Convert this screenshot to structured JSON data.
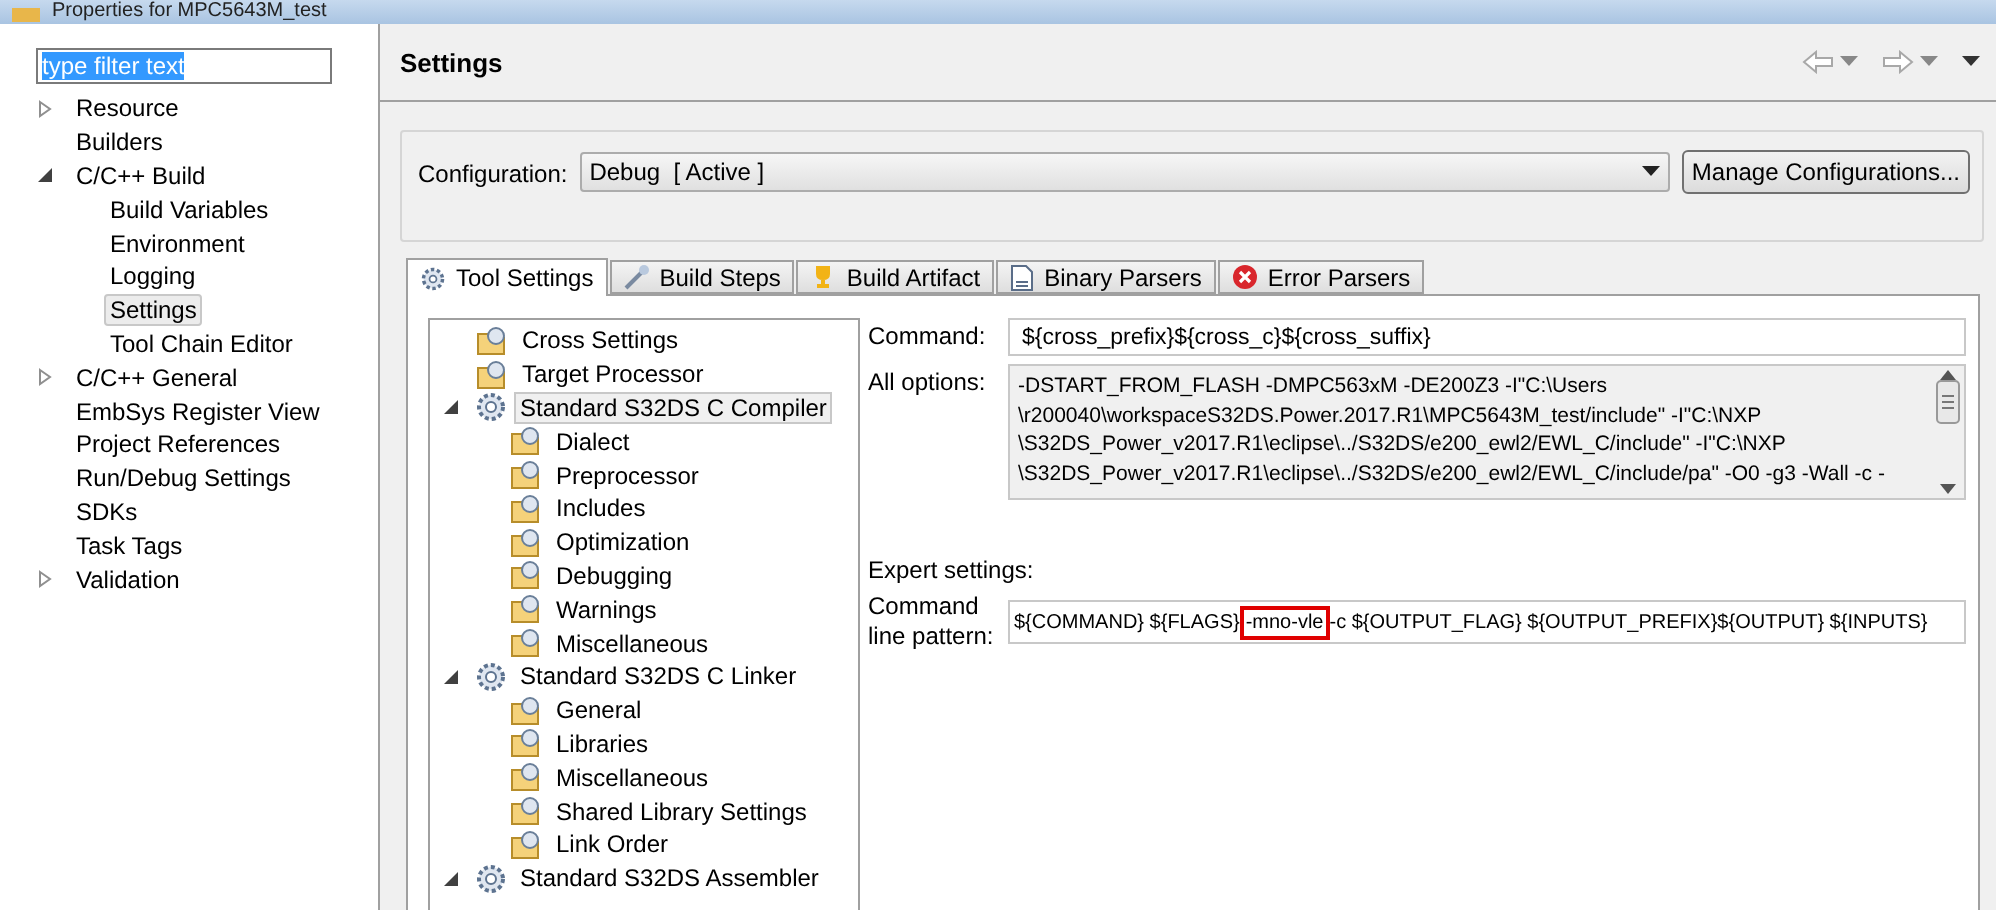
{
  "window": {
    "title": "Properties for MPC5643M_test"
  },
  "filter": {
    "value": "type filter text"
  },
  "nav_tree": [
    {
      "label": "Resource",
      "expanded": false,
      "selected": false
    },
    {
      "label": "Builders",
      "selected": false
    },
    {
      "label": "C/C++ Build",
      "expanded": true,
      "selected": false,
      "children": [
        {
          "label": "Build Variables",
          "selected": false
        },
        {
          "label": "Environment",
          "selected": false
        },
        {
          "label": "Logging",
          "selected": false
        },
        {
          "label": "Settings",
          "selected": true
        },
        {
          "label": "Tool Chain Editor",
          "selected": false
        }
      ]
    },
    {
      "label": "C/C++ General",
      "expanded": false,
      "selected": false
    },
    {
      "label": "EmbSys Register View",
      "selected": false
    },
    {
      "label": "Project References",
      "selected": false
    },
    {
      "label": "Run/Debug Settings",
      "selected": false
    },
    {
      "label": "SDKs",
      "selected": false
    },
    {
      "label": "Task Tags",
      "selected": false
    },
    {
      "label": "Validation",
      "expanded": false,
      "selected": false
    }
  ],
  "page": {
    "title": "Settings"
  },
  "configuration": {
    "label": "Configuration:",
    "value": "Debug  [ Active ]",
    "button": "Manage Configurations..."
  },
  "tabs": [
    {
      "label": "Tool Settings",
      "kind": "gear",
      "selected": true
    },
    {
      "label": "Build Steps",
      "kind": "wand",
      "selected": false
    },
    {
      "label": "Build Artifact",
      "kind": "trophy",
      "selected": false
    },
    {
      "label": "Binary Parsers",
      "kind": "binary",
      "selected": false
    },
    {
      "label": "Error Parsers",
      "kind": "error",
      "selected": false
    }
  ],
  "tool_tree": [
    {
      "label": "Cross Settings",
      "kind": "folder",
      "selected": false
    },
    {
      "label": "Target Processor",
      "kind": "folder",
      "selected": false
    },
    {
      "label": "Standard S32DS C Compiler",
      "kind": "tool",
      "expanded": true,
      "selected": true,
      "children": [
        {
          "label": "Dialect",
          "kind": "folder",
          "selected": false
        },
        {
          "label": "Preprocessor",
          "kind": "folder",
          "selected": false
        },
        {
          "label": "Includes",
          "kind": "folder",
          "selected": false
        },
        {
          "label": "Optimization",
          "kind": "folder",
          "selected": false
        },
        {
          "label": "Debugging",
          "kind": "folder",
          "selected": false
        },
        {
          "label": "Warnings",
          "kind": "folder",
          "selected": false
        },
        {
          "label": "Miscellaneous",
          "kind": "folder",
          "selected": false
        }
      ]
    },
    {
      "label": "Standard S32DS C Linker",
      "kind": "tool",
      "expanded": true,
      "selected": false,
      "children": [
        {
          "label": "General",
          "kind": "folder",
          "selected": false
        },
        {
          "label": "Libraries",
          "kind": "folder",
          "selected": false
        },
        {
          "label": "Miscellaneous",
          "kind": "folder",
          "selected": false
        },
        {
          "label": "Shared Library Settings",
          "kind": "folder",
          "selected": false
        },
        {
          "label": "Link Order",
          "kind": "folder",
          "selected": false
        }
      ]
    },
    {
      "label": "Standard S32DS Assembler",
      "kind": "tool",
      "expanded": true,
      "selected": false
    }
  ],
  "command": {
    "label": "Command:",
    "value": "${cross_prefix}${cross_c}${cross_suffix}"
  },
  "all_options": {
    "label": "All options:",
    "lines": [
      "-DSTART_FROM_FLASH -DMPC563xM -DE200Z3 -I\"C:\\Users",
      "\\r200040\\workspaceS32DS.Power.2017.R1\\MPC5643M_test/include\" -I\"C:\\NXP",
      "\\S32DS_Power_v2017.R1\\eclipse\\../S32DS/e200_ewl2/EWL_C/include\" -I\"C:\\NXP",
      "\\S32DS_Power_v2017.R1\\eclipse\\../S32DS/e200_ewl2/EWL_C/include/pa\" -O0 -g3 -Wall -c -"
    ]
  },
  "expert": {
    "heading": "Expert settings:",
    "label": "Command line pattern:",
    "pattern": {
      "before": "${COMMAND} ${FLAGS}",
      "highlighted": "-mno-vle",
      "after": "-c ${OUTPUT_FLAG} ${OUTPUT_PREFIX}${OUTPUT} ${INPUTS}"
    }
  }
}
